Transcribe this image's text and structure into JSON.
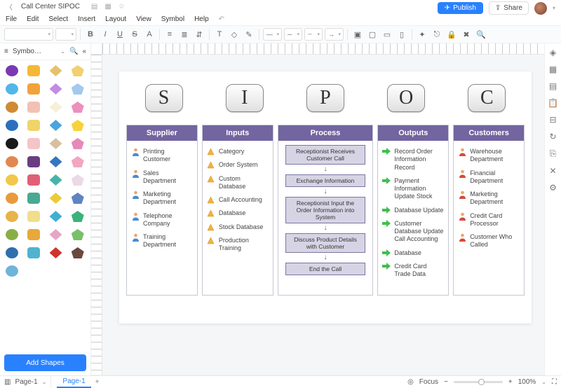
{
  "title": "Call Center SIPOC",
  "menus": [
    "File",
    "Edit",
    "Select",
    "Insert",
    "Layout",
    "View",
    "Symbol",
    "Help"
  ],
  "publish_label": "Publish",
  "share_label": "Share",
  "shapes_panel_label": "Symbo…",
  "add_shapes_label": "Add Shapes",
  "sipoc_letters": [
    "S",
    "I",
    "P",
    "O",
    "C"
  ],
  "columns": {
    "supplier": {
      "title": "Supplier",
      "items": [
        "Printing Customer",
        "Sales Department",
        "Marketing Department",
        "Telephone Company",
        "Training Department"
      ]
    },
    "inputs": {
      "title": "Inputs",
      "items": [
        "Category",
        "Order System",
        "Custom Database",
        "Call Accounting",
        "Database",
        "Stock Database",
        "Production Training"
      ]
    },
    "process": {
      "title": "Process",
      "steps": [
        "Receptionist Receives Customer Call",
        "Exchange Information",
        "Receptionist Input the Order Information into System",
        "Discuss Product Details with Customer",
        "End the Call"
      ]
    },
    "outputs": {
      "title": "Outputs",
      "items": [
        "Record Order Information Record",
        "Payment Information Update Stock",
        "Database Update",
        "Customer Database Update Call Accounting",
        "Database",
        "Credit Card Trade Data"
      ]
    },
    "customers": {
      "title": "Customers",
      "items": [
        "Warehouse Department",
        "Financial Department",
        "Marketing Department",
        "Credit Card Processor",
        "Customer Who Called"
      ]
    }
  },
  "status": {
    "page_select": "Page-1",
    "page_tab": "Page-1",
    "focus_label": "Focus",
    "zoom_label": "100%"
  },
  "shape_colors": [
    "#7a39b3",
    "#f5b836",
    "#e4c26d",
    "#f0d070",
    "#52b6e8",
    "#f2a23a",
    "#c58ae3",
    "#a3c9ed",
    "#cf8a33",
    "#f2c1b4",
    "#f6f0d9",
    "#ee8fbe",
    "#2b6fbd",
    "#f0d46a",
    "#4aa4e0",
    "#f6d23a",
    "#1a1a1a",
    "#f4c4c9",
    "#d8bfa0",
    "#e689b8",
    "#e2884f",
    "#6a3d82",
    "#3576c2",
    "#f2a6c0",
    "#f2c84b",
    "#e15f76",
    "#47b3a8",
    "#ead9e6",
    "#e89a3d",
    "#49a992",
    "#eacb3b",
    "#5f84c4",
    "#e7b34a",
    "#f0de8c",
    "#3fb0d1",
    "#3bb27a",
    "#8aae47",
    "#e8a93b",
    "#e7a6c4",
    "#79c06b",
    "#2f6fae",
    "#4fb3d0",
    "#d1332e",
    "#6a483e",
    "#6fb4da"
  ]
}
